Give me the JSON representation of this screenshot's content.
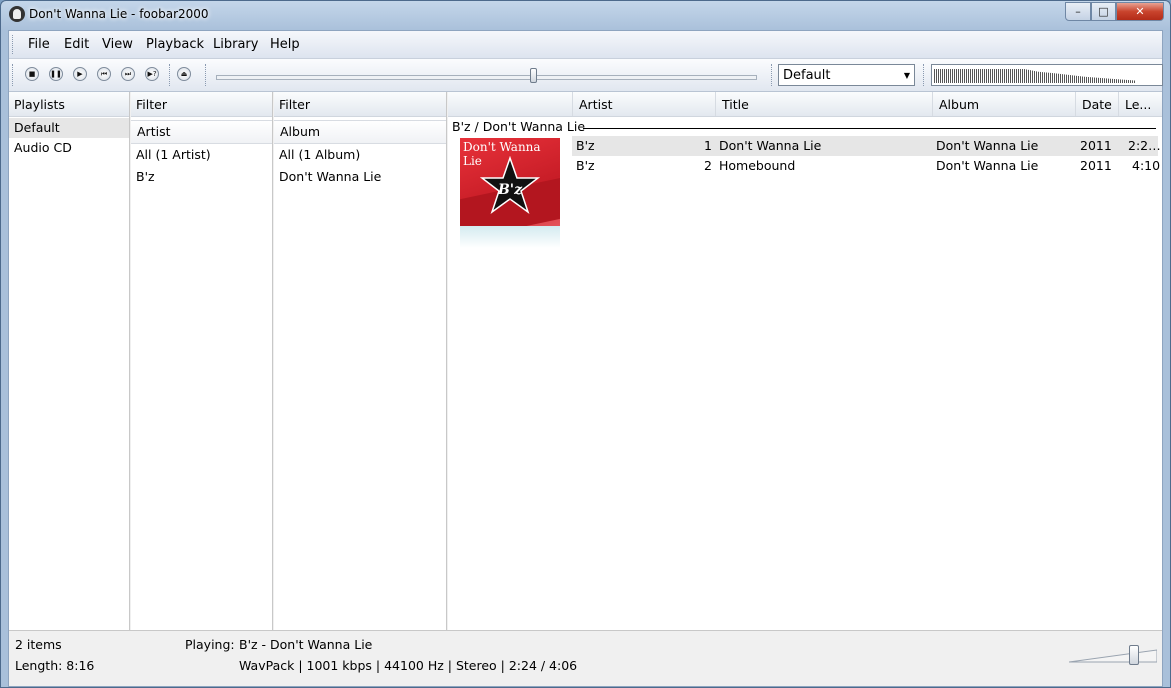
{
  "window": {
    "title": "Don't Wanna Lie - foobar2000",
    "controls": {
      "minimize": "–",
      "maximize": "□",
      "close": "✕"
    }
  },
  "menu": [
    "File",
    "Edit",
    "View",
    "Playback",
    "Library",
    "Help"
  ],
  "toolbar": {
    "buttons": [
      {
        "name": "stop",
        "glyph": "■"
      },
      {
        "name": "pause",
        "glyph": "❚❚"
      },
      {
        "name": "play",
        "glyph": "▶"
      },
      {
        "name": "previous",
        "glyph": "⏮"
      },
      {
        "name": "next",
        "glyph": "⏭"
      },
      {
        "name": "random",
        "glyph": "▶?"
      },
      {
        "name": "open",
        "glyph": "⏏"
      }
    ],
    "seek_position": 0.58,
    "output_combo": "Default"
  },
  "playlists": {
    "header": "Playlists",
    "items": [
      "Default",
      "Audio CD"
    ]
  },
  "filter_artist": {
    "header": "Filter",
    "column": "Artist",
    "items": [
      "All (1 Artist)",
      "B'z"
    ]
  },
  "filter_album": {
    "header": "Filter",
    "column": "Album",
    "items": [
      "All (1 Album)",
      "Don't Wanna Lie"
    ]
  },
  "playlist_view": {
    "columns": [
      "Artist",
      "Title",
      "Album",
      "Date",
      "Le..."
    ],
    "group": "B'z / Don't Wanna Lie",
    "cover_text": "Don't Wanna Lie",
    "cover_logo": "B'z",
    "tracks": [
      {
        "artist": "B'z",
        "num": "1",
        "title": "Don't Wanna Lie",
        "album": "Don't Wanna Lie",
        "date": "2011",
        "length": "2:2…"
      },
      {
        "artist": "B'z",
        "num": "2",
        "title": "Homebound",
        "album": "Don't Wanna Lie",
        "date": "2011",
        "length": "4:10"
      }
    ]
  },
  "status": {
    "items": "2 items",
    "length": "Length: 8:16",
    "playing_label": "Playing:",
    "playing": "B'z - Don't Wanna Lie",
    "tech": "WavPack | 1001 kbps | 44100 Hz | Stereo | 2:24 / 4:06",
    "volume_level": 0.75
  }
}
